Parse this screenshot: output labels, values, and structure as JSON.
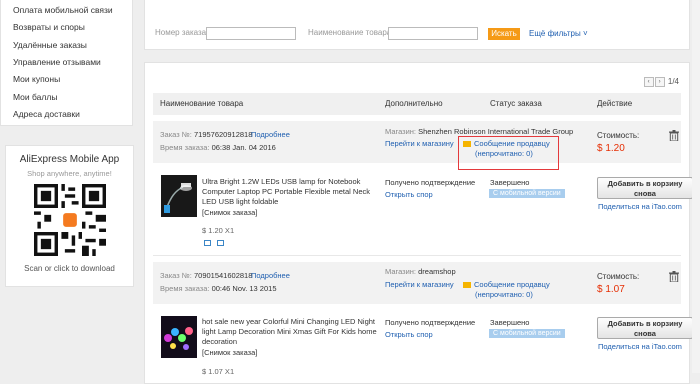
{
  "sidebar": {
    "items": [
      {
        "label": "Оплата мобильной связи"
      },
      {
        "label": "Возвраты и споры"
      },
      {
        "label": "Удалённые заказы"
      },
      {
        "label": "Управление отзывами"
      },
      {
        "label": "Мои купоны"
      },
      {
        "label": "Мои баллы"
      },
      {
        "label": "Адреса доставки"
      }
    ],
    "app": {
      "title": "AliExpress Mobile App",
      "subtitle": "Shop anywhere, anytime!",
      "download": "Scan or click to download"
    }
  },
  "search": {
    "order_no_label": "Номер заказа:",
    "order_no_value": "",
    "product_name_label": "Наименование товара:",
    "product_name_value": "",
    "search_button": "Искать",
    "more_filters": "Ещё фильтры ˅"
  },
  "pager": {
    "prev": "‹",
    "next": "›",
    "text": "1/4"
  },
  "table": {
    "headers": [
      "Наименование товара",
      "Дополнительно",
      "Статус заказа",
      "Действие"
    ]
  },
  "orders": [
    {
      "order_label": "Заказ №:",
      "order_no": "71957620912818",
      "details": "Подробнее",
      "time_label": "Время заказа:",
      "time": "06:38 Jan. 04 2016",
      "store_label": "Магазин:",
      "store": "Shenzhen Robinson International Trade Group",
      "go_store": "Перейти к магазину",
      "message": "Сообщение продавцу",
      "unread": "(непрочитано: 0)",
      "cost_label": "Стоимость:",
      "cost": "$ 1.20",
      "product_title": "Ultra Bright 1.2W LEDs USB lamp for Notebook Computer Laptop PC Portable Flexible metal Neck LED USB light foldable",
      "snapshot": "[Снимок заказа]",
      "price": "$ 1.20 X1",
      "confirm": "Получено подтверждение",
      "dispute": "Открыть спор",
      "status": "Завершено",
      "badge": "С мобильной версии",
      "cart_line1": "Добавить в корзину",
      "cart_line2": "снова",
      "share": "Поделиться на iTao.com"
    },
    {
      "order_label": "Заказ №:",
      "order_no": "70901541602818",
      "details": "Подробнее",
      "time_label": "Время заказа:",
      "time": "00:46 Nov. 13 2015",
      "store_label": "Магазин:",
      "store": "dreamshop",
      "go_store": "Перейти к магазину",
      "message": "Сообщение продавцу",
      "unread": "(непрочитано: 0)",
      "cost_label": "Стоимость:",
      "cost": "$ 1.07",
      "product_title": "hot sale new year Colorful Mini Changing LED Night light Lamp Decoration Mini Xmas Gift For Kids home decoration",
      "snapshot": "[Снимок заказа]",
      "price": "$ 1.07 X1",
      "confirm": "Получено подтверждение",
      "dispute": "Открыть спор",
      "status": "Завершено",
      "badge": "С мобильной версии",
      "cart_line1": "Добавить в корзину",
      "cart_line2": "снова",
      "share": "Поделиться на iTao.com"
    }
  ],
  "colors": {
    "accent": "#f59a16",
    "link": "#1f5fb0",
    "price": "#e62e04",
    "highlight": "#e4393c"
  }
}
